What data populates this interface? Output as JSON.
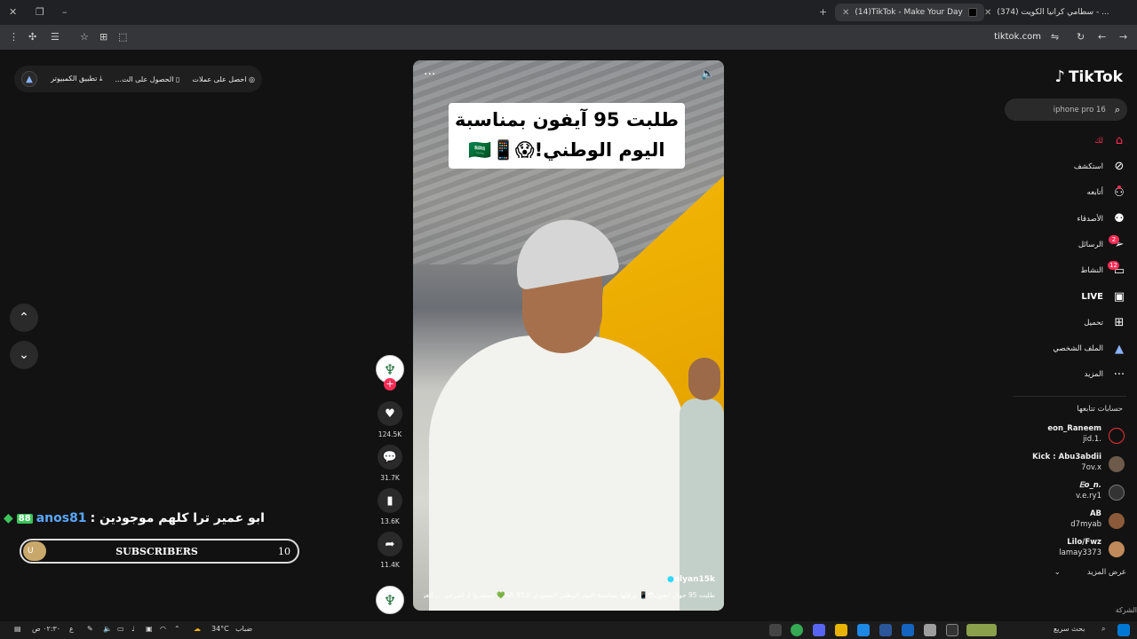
{
  "browser": {
    "tabs": [
      {
        "title": "(14)TikTok - Make Your Day",
        "active": true
      },
      {
        "title": "(374) سطامي كرانيا الكويت - ...",
        "active": false
      }
    ],
    "url": "tiktok.com"
  },
  "promo": {
    "get_coins": "احصل على عملات",
    "get_app": "الحصول على الت...",
    "pc_app": "تطبيق الكمبيوتر"
  },
  "chat": {
    "message": "ابو عمير ترا كلهم موجودين :",
    "username": "anos81",
    "badge": "88"
  },
  "subs_bar": {
    "label": "SUBSCRIBERS",
    "count": "10",
    "knob": "U"
  },
  "video": {
    "caption_line1": "طلبت 95 آيفون بمناسبة",
    "caption_line2": "اليوم الوطني!😱📱🇸🇦",
    "username": "olyan15k",
    "description": "طلبت 95 جوال ايفون😳📱 ورقلها بمناسبة اليوم الوطني السعودي الـ95 SA💚 استمروا لـ أشرجي ... العزيز"
  },
  "actions": {
    "likes": "124.5K",
    "comments": "31.7K",
    "saves": "13.6K",
    "shares": "11.4K"
  },
  "sidebar": {
    "logo": "TikTok",
    "search_placeholder": "iphone pro 16",
    "items": [
      {
        "label": "لك",
        "icon": "home-icon"
      },
      {
        "label": "استكشف",
        "icon": "explore-icon"
      },
      {
        "label": "أتابعه",
        "icon": "following-icon"
      },
      {
        "label": "الأصدقاء",
        "icon": "friends-icon"
      },
      {
        "label": "الرسائل",
        "icon": "messages-icon",
        "badge": "2"
      },
      {
        "label": "النشاط",
        "icon": "activity-icon",
        "badge": "12"
      },
      {
        "label": "LIVE",
        "icon": "live-icon"
      },
      {
        "label": "تحميل",
        "icon": "upload-icon"
      },
      {
        "label": "الملف الشخصي",
        "icon": "profile-icon"
      },
      {
        "label": "المزيد",
        "icon": "more-icon"
      }
    ],
    "following_title": "حسابات تتابعها",
    "accounts": [
      {
        "name": "eon_Raneem",
        "handle": "jid.1."
      },
      {
        "name": "Kick : Abu3abdii",
        "handle": "7ov.x"
      },
      {
        "name": "Ꭼo_n.",
        "handle": "v.e.ry1"
      },
      {
        "name": "AB",
        "handle": "d7myab"
      },
      {
        "name": "Lilo/Fwz",
        "handle": "lamay3373"
      }
    ],
    "see_more": "عرض المزيد",
    "corner": "الشركة"
  },
  "taskbar": {
    "search": "بحث سريع",
    "weather_temp": "34°C",
    "weather_desc": "ضباب",
    "time": "٠٢:٣٠ ص",
    "lang": "ع"
  },
  "colors": {
    "accent": "#fe2c55",
    "background": "#121212"
  }
}
